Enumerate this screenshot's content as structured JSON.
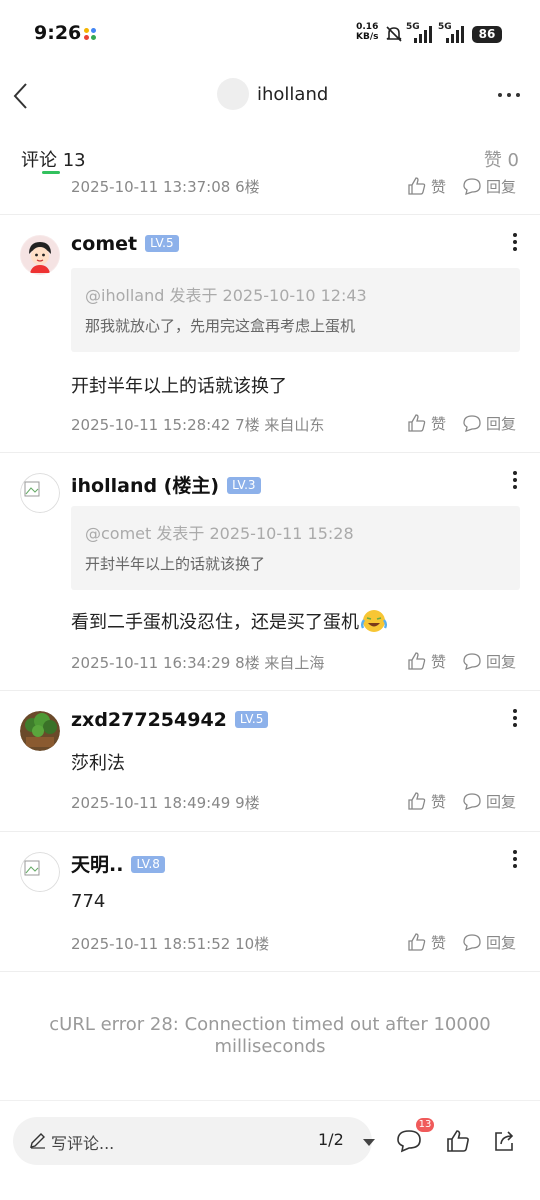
{
  "status": {
    "time": "9:26",
    "net_speed_value": "0.16",
    "net_speed_unit": "KB/s",
    "sim1": "5G",
    "sim2": "5G",
    "battery": "86"
  },
  "header": {
    "username": "iholland"
  },
  "tabs": {
    "comments_label": "评论",
    "comments_count": "13",
    "likes_label": "赞 0"
  },
  "partial_comment": {
    "meta": "2025-10-11 13:37:08  6楼",
    "like": "赞",
    "reply": "回复"
  },
  "comments": [
    {
      "name": "comet",
      "level": "LV.5",
      "quote_head": "@iholland 发表于 2025-10-10 12:43",
      "quote_text": "那我就放心了，先用完这盒再考虑上蛋机",
      "body": "开封半年以上的话就该换了",
      "meta": "2025-10-11 15:28:42  7楼   来自山东",
      "like": "赞",
      "reply": "回复"
    },
    {
      "name": "iholland (楼主)",
      "level": "LV.3",
      "quote_head": "@comet 发表于 2025-10-11 15:28",
      "quote_text": "开封半年以上的话就该换了",
      "body": "看到二手蛋机没忍住，还是买了蛋机",
      "meta": "2025-10-11 16:34:29  8楼   来自上海",
      "like": "赞",
      "reply": "回复"
    },
    {
      "name": "zxd277254942",
      "level": "LV.5",
      "body": "莎利法",
      "meta": "2025-10-11 18:49:49  9楼",
      "like": "赞",
      "reply": "回复"
    },
    {
      "name": "天明..",
      "level": "LV.8",
      "body": "774",
      "meta": "2025-10-11 18:51:52  10楼",
      "like": "赞",
      "reply": "回复"
    }
  ],
  "error_text": "cURL error 28: Connection timed out after 10000 milliseconds",
  "bottom": {
    "write_placeholder": "写评论...",
    "page_indicator": "1/2",
    "comment_badge": "13"
  },
  "colors": {
    "accent_green": "#32c15e",
    "level_badge": "#8db1ea",
    "badge_red": "#f05a5a"
  }
}
